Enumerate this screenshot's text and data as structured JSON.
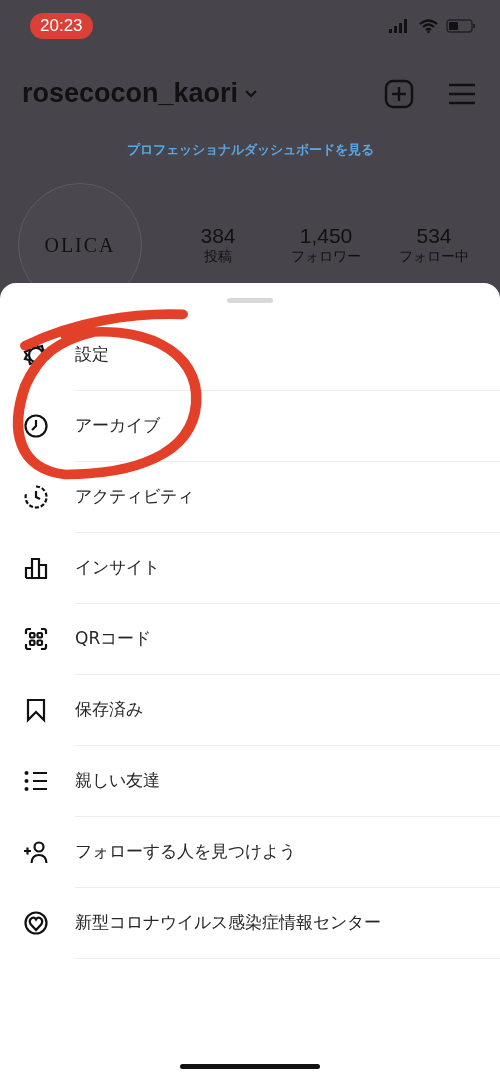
{
  "status_bar": {
    "time": "20:23"
  },
  "profile": {
    "username": "rosecocon_kaori",
    "dashboard_link": "プロフェッショナルダッシュボードを見る",
    "avatar_text": "OLICA",
    "stats": [
      {
        "value": "384",
        "label": "投稿"
      },
      {
        "value": "1,450",
        "label": "フォロワー"
      },
      {
        "value": "534",
        "label": "フォロー中"
      }
    ]
  },
  "menu": {
    "items": [
      {
        "label": "設定"
      },
      {
        "label": "アーカイブ"
      },
      {
        "label": "アクティビティ"
      },
      {
        "label": "インサイト"
      },
      {
        "label": "QRコード"
      },
      {
        "label": "保存済み"
      },
      {
        "label": "親しい友達"
      },
      {
        "label": "フォローする人を見つけよう"
      },
      {
        "label": "新型コロナウイルス感染症情報センター"
      }
    ]
  }
}
